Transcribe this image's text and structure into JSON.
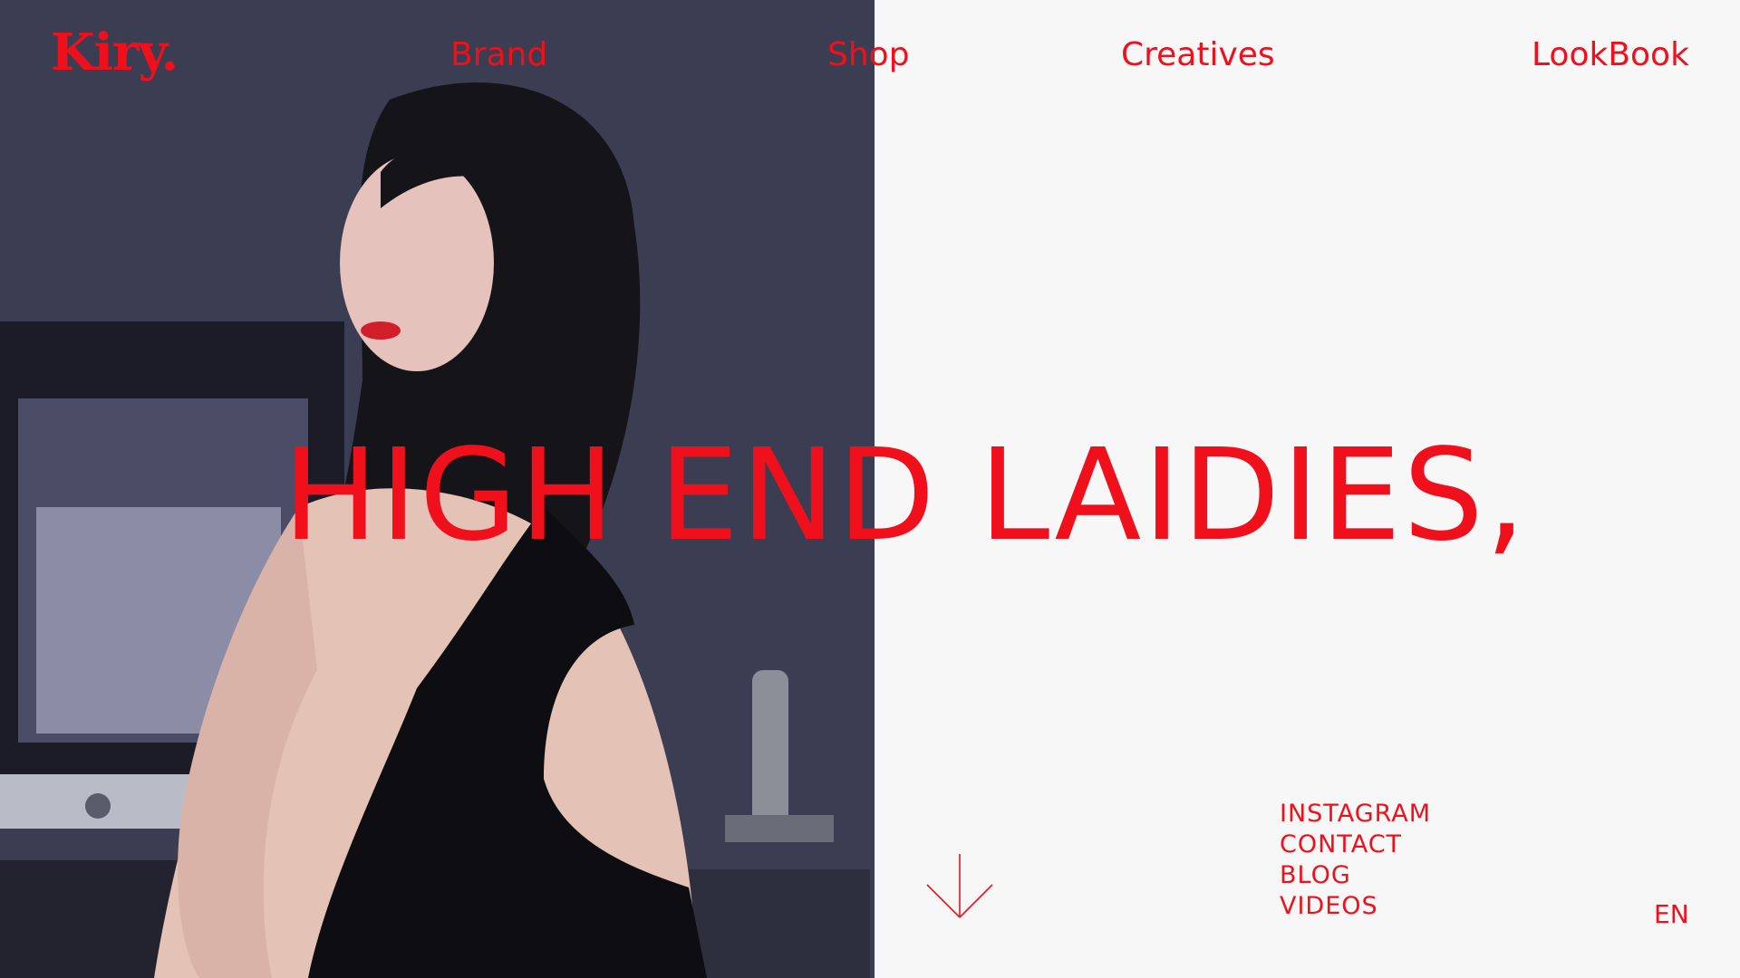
{
  "brand": {
    "logo_text": "Kiry."
  },
  "nav": {
    "brand": "Brand",
    "shop": "Shop",
    "creatives": "Creatives",
    "lookbook": "LookBook"
  },
  "hero": {
    "headline": "HIGH END LAIDIES,",
    "scroll_icon": "arrow-down-icon"
  },
  "links": {
    "instagram": "INSTAGRAM",
    "contact": "CONTACT",
    "blog": "BLOG",
    "videos": "VIDEOS"
  },
  "language": {
    "current": "EN"
  },
  "colors": {
    "accent": "#f0101c",
    "background": "#f7f7f7"
  }
}
